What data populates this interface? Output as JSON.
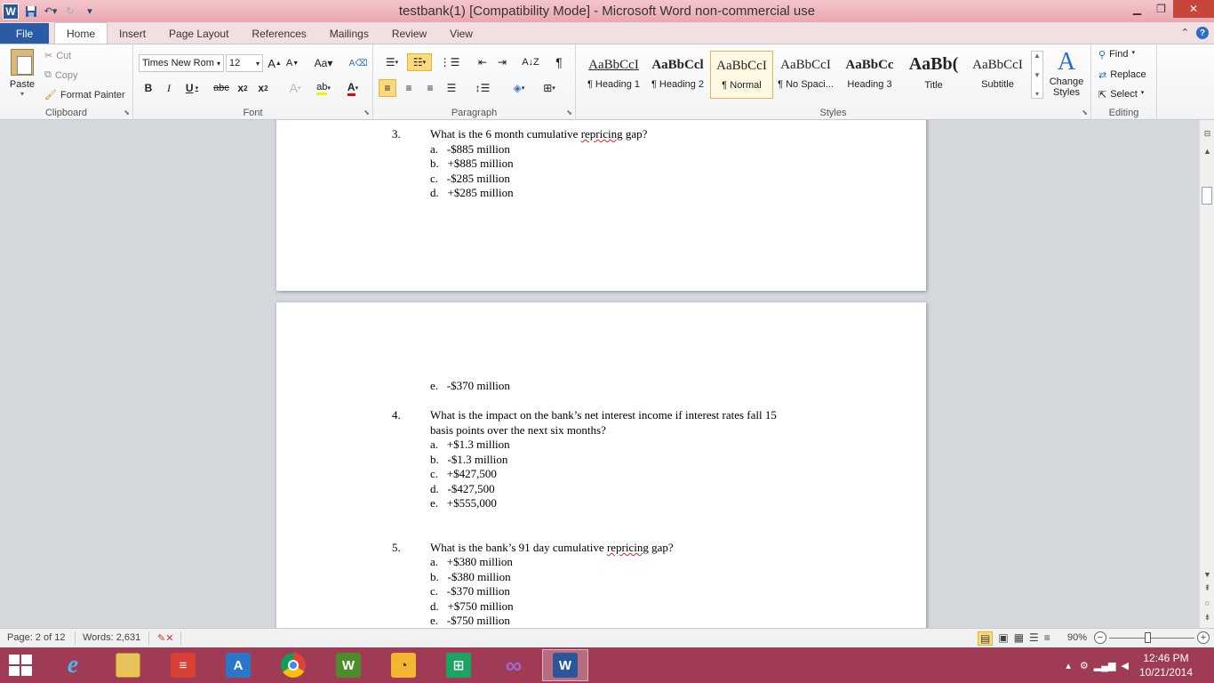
{
  "window": {
    "title": "testbank(1) [Compatibility Mode]  -  Microsoft Word non-commercial use"
  },
  "ribbon": {
    "file_tab": "File",
    "tabs": [
      "Home",
      "Insert",
      "Page Layout",
      "References",
      "Mailings",
      "Review",
      "View"
    ],
    "active_tab": "Home",
    "clipboard": {
      "label": "Clipboard",
      "paste": "Paste",
      "cut": "Cut",
      "copy": "Copy",
      "format_painter": "Format Painter"
    },
    "font": {
      "label": "Font",
      "font_name": "Times New Rom",
      "font_size": "12"
    },
    "paragraph": {
      "label": "Paragraph"
    },
    "styles": {
      "label": "Styles",
      "items": [
        {
          "sample": "AaBbCcI",
          "name": "¶ Heading 1"
        },
        {
          "sample": "AaBbCcl",
          "name": "¶ Heading 2"
        },
        {
          "sample": "AaBbCcI",
          "name": "¶ Normal"
        },
        {
          "sample": "AaBbCcI",
          "name": "¶ No Spaci..."
        },
        {
          "sample": "AaBbCc",
          "name": "Heading 3"
        },
        {
          "sample": "AaBb(",
          "name": "Title"
        },
        {
          "sample": "AaBbCcI",
          "name": "Subtitle"
        }
      ],
      "active": "¶ Normal",
      "change_styles": "Change Styles"
    },
    "editing": {
      "label": "Editing",
      "find": "Find",
      "replace": "Replace",
      "select": "Select"
    }
  },
  "document": {
    "q3": {
      "num": "3.",
      "text_pre": "What is the 6 month cumulative ",
      "text_flag": "repricing",
      "text_post": " gap?",
      "options": [
        {
          "letter": "a.",
          "text": "-$885 million"
        },
        {
          "letter": "b.",
          "text": "+$885 million"
        },
        {
          "letter": "c.",
          "text": "-$285 million"
        },
        {
          "letter": "d.",
          "text": "+$285 million"
        }
      ],
      "option_e": {
        "letter": "e.",
        "text": "-$370 million"
      }
    },
    "q4": {
      "num": "4.",
      "line1": "What is the impact on the bank’s net interest income if interest rates fall 15",
      "line2": "basis points over the next six months?",
      "options": [
        {
          "letter": "a.",
          "text": "+$1.3 million"
        },
        {
          "letter": "b.",
          "text": "-$1.3 million"
        },
        {
          "letter": "c.",
          "text": "+$427,500"
        },
        {
          "letter": "d.",
          "text": "-$427,500"
        },
        {
          "letter": "e.",
          "text": "+$555,000"
        }
      ]
    },
    "q5": {
      "num": "5.",
      "text_pre": "What is the bank’s 91 day cumulative ",
      "text_flag": "repricing",
      "text_post": " gap?",
      "options": [
        {
          "letter": "a.",
          "text": "+$380 million"
        },
        {
          "letter": "b.",
          "text": "-$380 million"
        },
        {
          "letter": "c.",
          "text": "-$370 million"
        },
        {
          "letter": "d.",
          "text": "+$750 million"
        },
        {
          "letter": "e.",
          "text": "-$750 million"
        }
      ]
    }
  },
  "status": {
    "page": "Page: 2 of 12",
    "words": "Words: 2,631",
    "zoom": "90%"
  },
  "taskbar": {
    "time": "12:46 PM",
    "date": "10/21/2014"
  },
  "colors": {
    "title_bar": "#e9a7b0",
    "file_tab": "#2a5ca6",
    "taskbar": "#a03b55",
    "selected_style": "#fff8e2"
  }
}
